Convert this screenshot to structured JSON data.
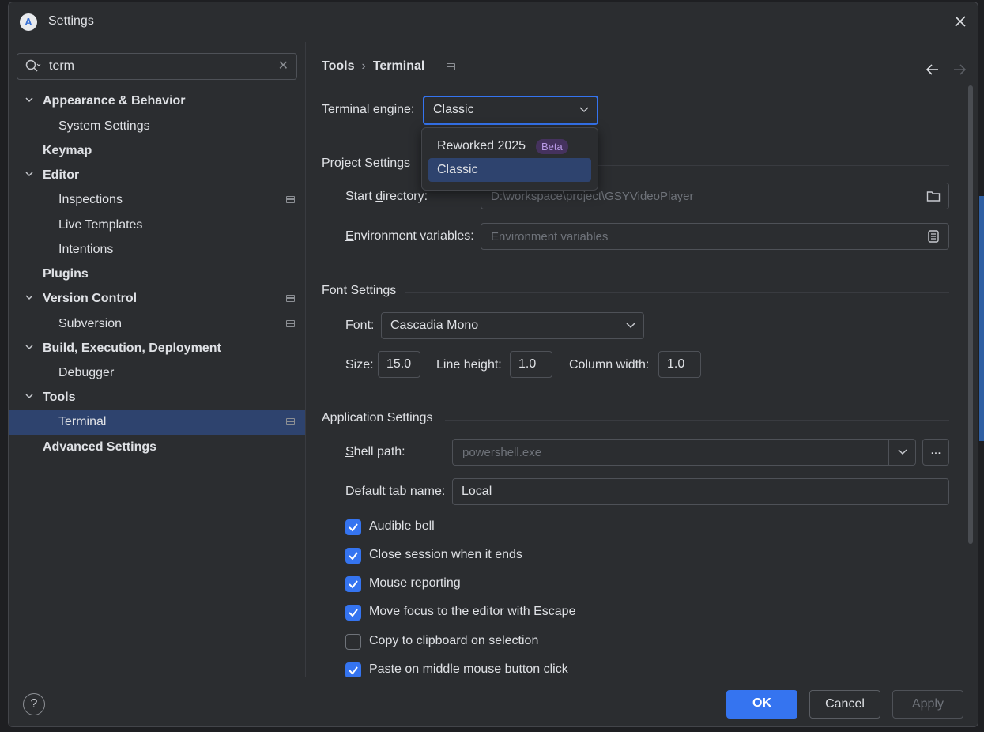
{
  "window": {
    "title": "Settings",
    "logo_letter": "A"
  },
  "search": {
    "value": "term"
  },
  "tree": [
    {
      "label": "Appearance & Behavior",
      "level": 0,
      "bold": true,
      "expanded": true
    },
    {
      "label": "System Settings",
      "level": 1,
      "bold": false
    },
    {
      "label": "Keymap",
      "level": 0,
      "bold": true
    },
    {
      "label": "Editor",
      "level": 0,
      "bold": true,
      "expanded": true
    },
    {
      "label": "Inspections",
      "level": 1,
      "bold": false,
      "project_icon": true
    },
    {
      "label": "Live Templates",
      "level": 1,
      "bold": false
    },
    {
      "label": "Intentions",
      "level": 1,
      "bold": false
    },
    {
      "label": "Plugins",
      "level": 0,
      "bold": true
    },
    {
      "label": "Version Control",
      "level": 0,
      "bold": true,
      "expanded": true,
      "project_icon": true
    },
    {
      "label": "Subversion",
      "level": 1,
      "bold": false,
      "project_icon": true
    },
    {
      "label": "Build, Execution, Deployment",
      "level": 0,
      "bold": true,
      "expanded": true
    },
    {
      "label": "Debugger",
      "level": 1,
      "bold": false
    },
    {
      "label": "Tools",
      "level": 0,
      "bold": true,
      "expanded": true
    },
    {
      "label": "Terminal",
      "level": 1,
      "bold": false,
      "selected": true,
      "project_icon": true
    },
    {
      "label": "Advanced Settings",
      "level": 0,
      "bold": true
    }
  ],
  "breadcrumb": {
    "parent": "Tools",
    "separator": "›",
    "current": "Terminal"
  },
  "terminal_engine": {
    "label": "Terminal engine:",
    "value": "Classic",
    "options": [
      {
        "label": "Reworked 2025",
        "badge": "Beta"
      },
      {
        "label": "Classic",
        "selected": true
      }
    ]
  },
  "project_settings": {
    "title": "Project Settings",
    "start_directory_label_pre": "Start ",
    "start_directory_label_u": "d",
    "start_directory_label_post": "irectory:",
    "start_directory_placeholder": "D:\\workspace\\project\\GSYVideoPlayer",
    "env_label_u": "E",
    "env_label_post": "nvironment variables:",
    "env_placeholder": "Environment variables"
  },
  "font_settings": {
    "title": "Font Settings",
    "font_label_u": "F",
    "font_label_post": "ont:",
    "font_value": "Cascadia Mono",
    "size_label": "Size:",
    "size_value": "15.0",
    "line_height_label": "Line height:",
    "line_height_value": "1.0",
    "column_width_label": "Column width:",
    "column_width_value": "1.0"
  },
  "app_settings": {
    "title": "Application Settings",
    "shell_label_u": "S",
    "shell_label_post": "hell path:",
    "shell_placeholder": "powershell.exe",
    "ellipsis": "...",
    "tab_label_pre": "Default ",
    "tab_label_u": "t",
    "tab_label_post": "ab name:",
    "tab_value": "Local"
  },
  "checkboxes": [
    {
      "label": "Audible bell",
      "checked": true
    },
    {
      "label": "Close session when it ends",
      "checked": true
    },
    {
      "label": "Mouse reporting",
      "checked": true
    },
    {
      "label": "Move focus to the editor with Escape",
      "checked": true
    },
    {
      "label": "Copy to clipboard on selection",
      "checked": false
    },
    {
      "label": "Paste on middle mouse button click",
      "checked": true
    }
  ],
  "footer": {
    "help": "?",
    "ok": "OK",
    "cancel": "Cancel",
    "apply": "Apply"
  },
  "colors": {
    "accent": "#3574f0",
    "selection": "#2e436e",
    "beta_bg": "#45325e",
    "beta_fg": "#b99ae6"
  }
}
